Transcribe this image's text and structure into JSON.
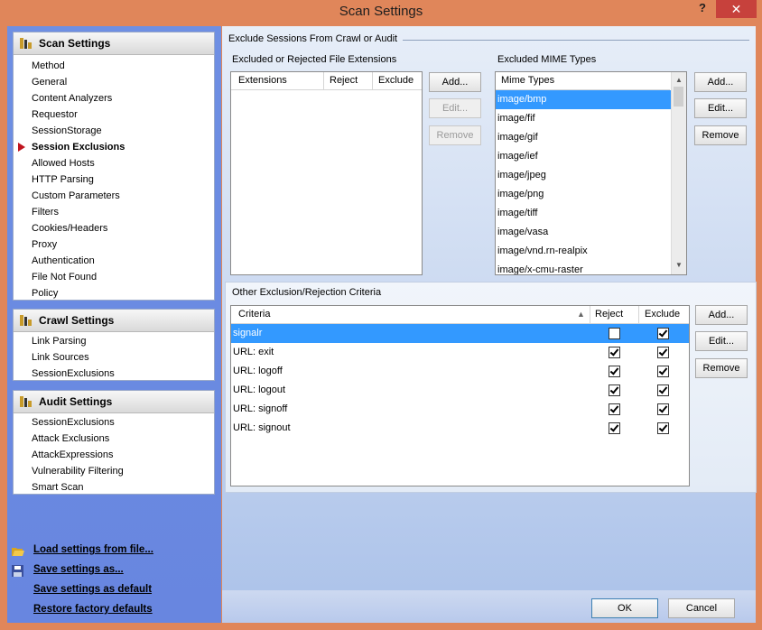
{
  "window": {
    "title": "Scan Settings",
    "help": "?",
    "close": "✕"
  },
  "nav": {
    "scan": {
      "title": "Scan Settings",
      "items": [
        "Method",
        "General",
        "Content Analyzers",
        "Requestor",
        "SessionStorage",
        "Session Exclusions",
        "Allowed Hosts",
        "HTTP Parsing",
        "Custom Parameters",
        "Filters",
        "Cookies/Headers",
        "Proxy",
        "Authentication",
        "File Not Found",
        "Policy"
      ],
      "active_index": 5
    },
    "crawl": {
      "title": "Crawl Settings",
      "items": [
        "Link Parsing",
        "Link Sources",
        "SessionExclusions"
      ]
    },
    "audit": {
      "title": "Audit Settings",
      "items": [
        "SessionExclusions",
        "Attack Exclusions",
        "AttackExpressions",
        "Vulnerability Filtering",
        "Smart Scan"
      ]
    }
  },
  "links": {
    "load": "Load settings from file...",
    "save_as": "Save settings as...",
    "save_default": "Save settings as default",
    "restore": "Restore factory defaults"
  },
  "main": {
    "section_title": "Exclude Sessions From Crawl or Audit",
    "extensions": {
      "title": "Excluded or Rejected File Extensions",
      "columns": [
        "Extensions",
        "Reject",
        "Exclude"
      ],
      "buttons": [
        "Add...",
        "Edit...",
        "Remove"
      ]
    },
    "mime": {
      "title": "Excluded MIME Types",
      "column": "Mime Types",
      "items": [
        "image/bmp",
        "image/fif",
        "image/gif",
        "image/ief",
        "image/jpeg",
        "image/png",
        "image/tiff",
        "image/vasa",
        "image/vnd.rn-realpix",
        "image/x-cmu-raster"
      ],
      "selected_index": 0,
      "buttons": [
        "Add...",
        "Edit...",
        "Remove"
      ]
    },
    "criteria": {
      "title": "Other Exclusion/Rejection Criteria",
      "columns": [
        "Criteria",
        "Reject",
        "Exclude"
      ],
      "rows": [
        {
          "label": "signalr",
          "reject": false,
          "exclude": true
        },
        {
          "label": "URL: exit",
          "reject": true,
          "exclude": true
        },
        {
          "label": "URL: logoff",
          "reject": true,
          "exclude": true
        },
        {
          "label": "URL: logout",
          "reject": true,
          "exclude": true
        },
        {
          "label": "URL: signoff",
          "reject": true,
          "exclude": true
        },
        {
          "label": "URL: signout",
          "reject": true,
          "exclude": true
        }
      ],
      "selected_index": 0,
      "buttons": [
        "Add...",
        "Edit...",
        "Remove"
      ]
    }
  },
  "footer": {
    "ok": "OK",
    "cancel": "Cancel"
  }
}
